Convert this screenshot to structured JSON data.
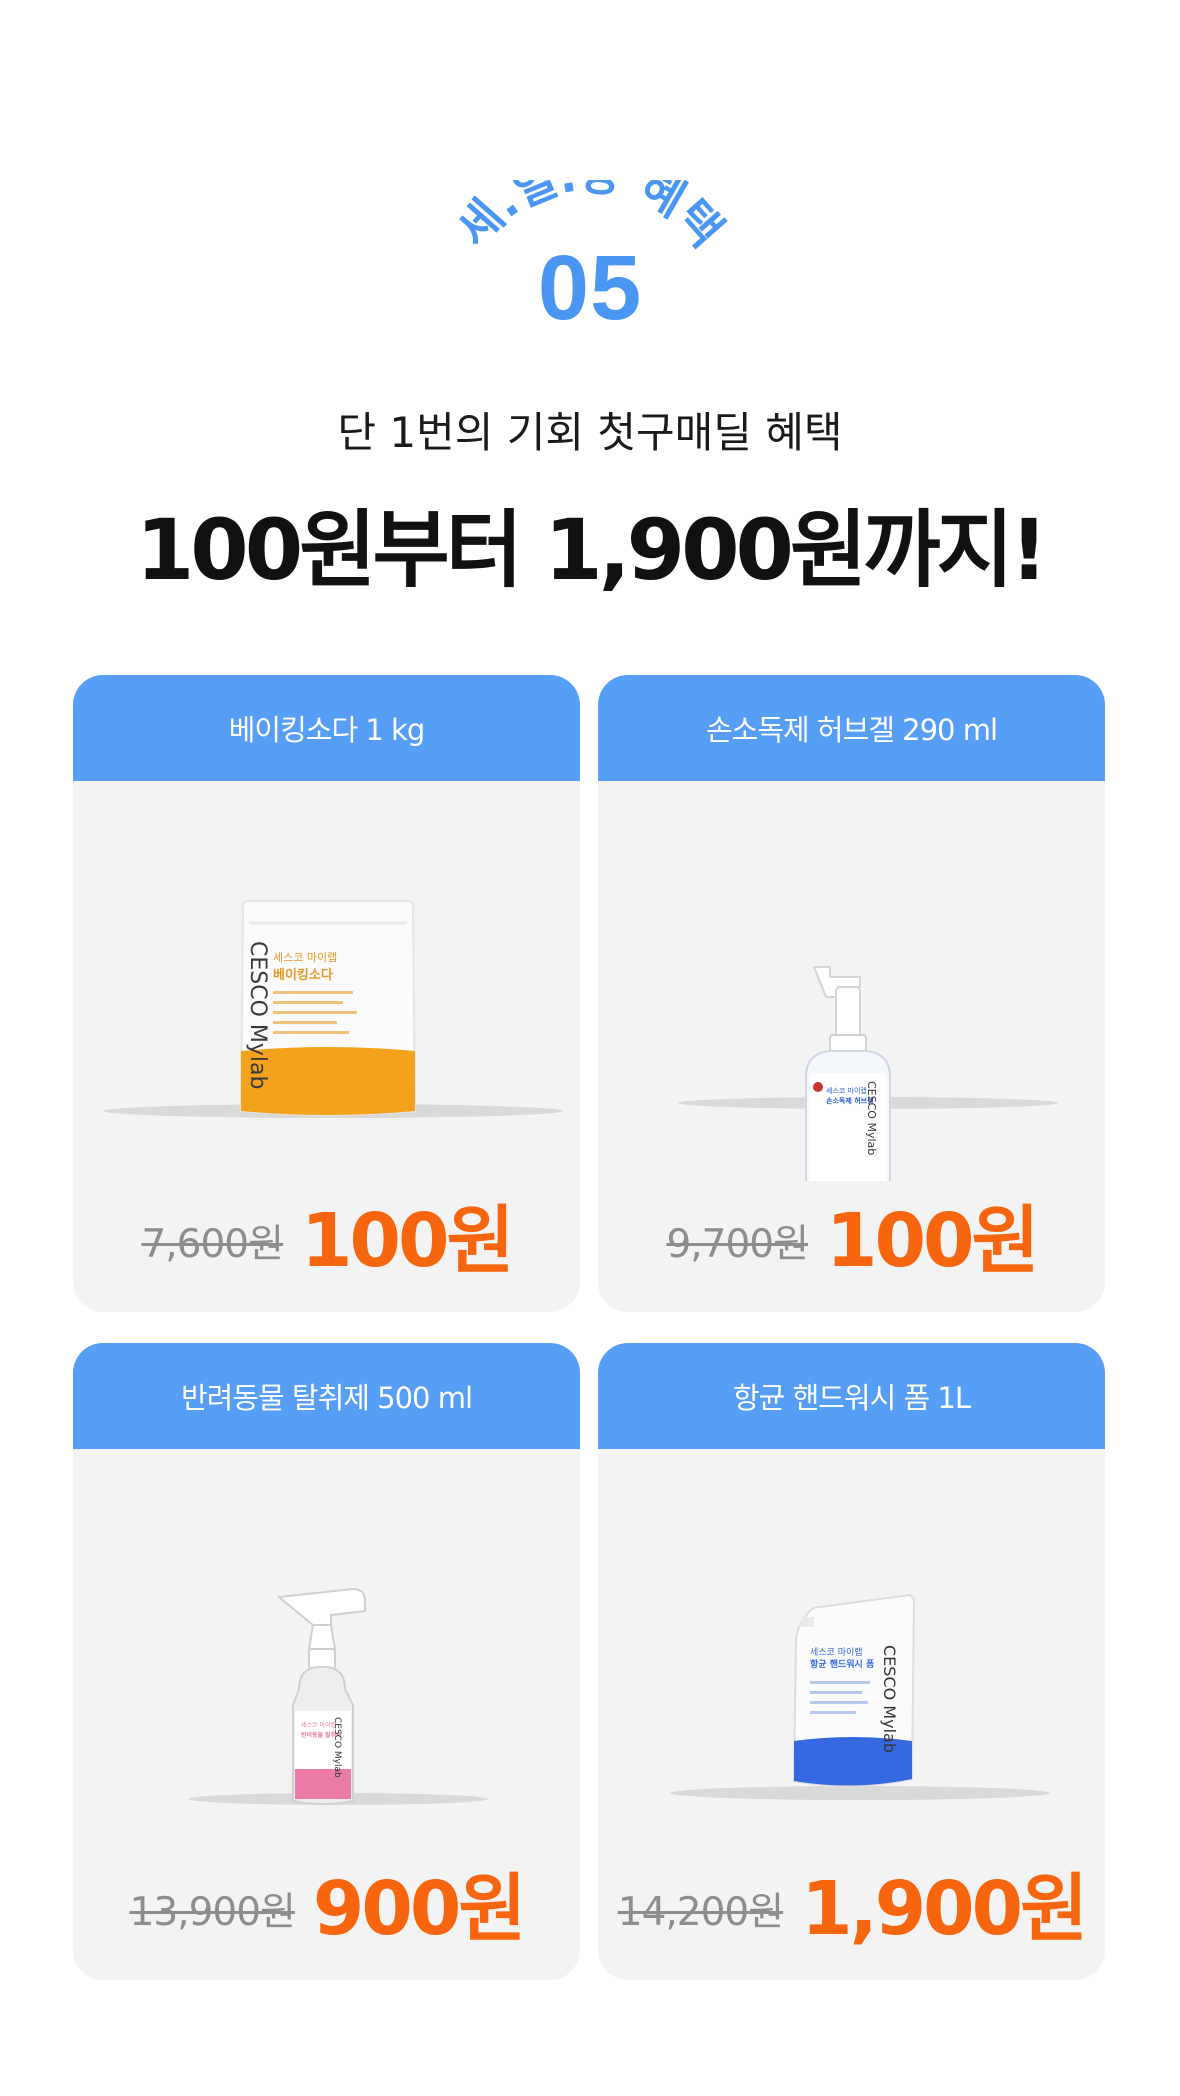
{
  "badge": {
    "arc_text": "세.일.장 혜택",
    "number": "05"
  },
  "subtitle": "단 1번의 기회 첫구매딜 혜택",
  "headline": "100원부터 1,900원까지!",
  "products": [
    {
      "title": "베이킹소다 1 kg",
      "old_price": "7,600원",
      "new_price": "100원",
      "accent": "#f4a21b",
      "pkg_brand": "CESCO Mylab",
      "pkg_line1": "세스코 마이랩",
      "pkg_line2": "베이킹소다"
    },
    {
      "title": "손소독제 허브겔 290 ml",
      "old_price": "9,700원",
      "new_price": "100원",
      "accent": "#2e5fd1",
      "pkg_brand": "CESCO Mylab",
      "pkg_line1": "세스코 마이랩",
      "pkg_line2": "손소독제 허브겔"
    },
    {
      "title": "반려동물 탈취제 500 ml",
      "old_price": "13,900원",
      "new_price": "900원",
      "accent": "#e97ba6",
      "pkg_brand": "CESCO Mylab",
      "pkg_line1": "세스코 마이랩",
      "pkg_line2": "반려동물 탈취제"
    },
    {
      "title": "항균 핸드워시 폼 1L",
      "old_price": "14,200원",
      "new_price": "1,900원",
      "accent": "#3668e0",
      "pkg_brand": "CESCO Mylab",
      "pkg_line1": "세스코 마이랩",
      "pkg_line2": "항균 핸드워시 폼"
    }
  ],
  "colors": {
    "primary_blue": "#579ef6",
    "badge_blue": "#4a97f3",
    "price_orange": "#f7660f",
    "card_bg": "#f3f3f3"
  }
}
